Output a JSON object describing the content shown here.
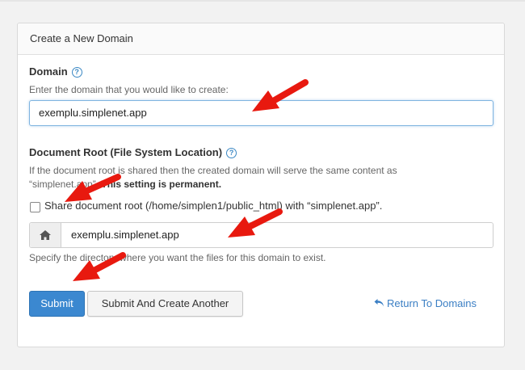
{
  "panel": {
    "title": "Create a New Domain"
  },
  "domain": {
    "label": "Domain",
    "help": "?",
    "hint": "Enter the domain that you would like to create:",
    "value": "exemplu.simplenet.app"
  },
  "docroot": {
    "label": "Document Root (File System Location)",
    "help": "?",
    "hint_line1": "If the document root is shared then the created domain will serve the same content as",
    "hint_line2_prefix": "“simplenet.app”. ",
    "hint_line2_bold": "This setting is permanent.",
    "checkbox_label": "Share document root (/home/simplen1/public_html) with “simplenet.app”.",
    "checkbox_checked": false,
    "value": "exemplu.simplenet.app",
    "home_icon": "home-icon",
    "specify_hint": "Specify the directory where you want the files for this domain to exist."
  },
  "actions": {
    "submit_label": "Submit",
    "submit_another_label": "Submit And Create Another",
    "return_label": "Return To Domains",
    "return_icon": "return-arrow-icon"
  },
  "annotation": {
    "arrow_color": "#e8190f",
    "arrow_icon": "red-arrow"
  }
}
